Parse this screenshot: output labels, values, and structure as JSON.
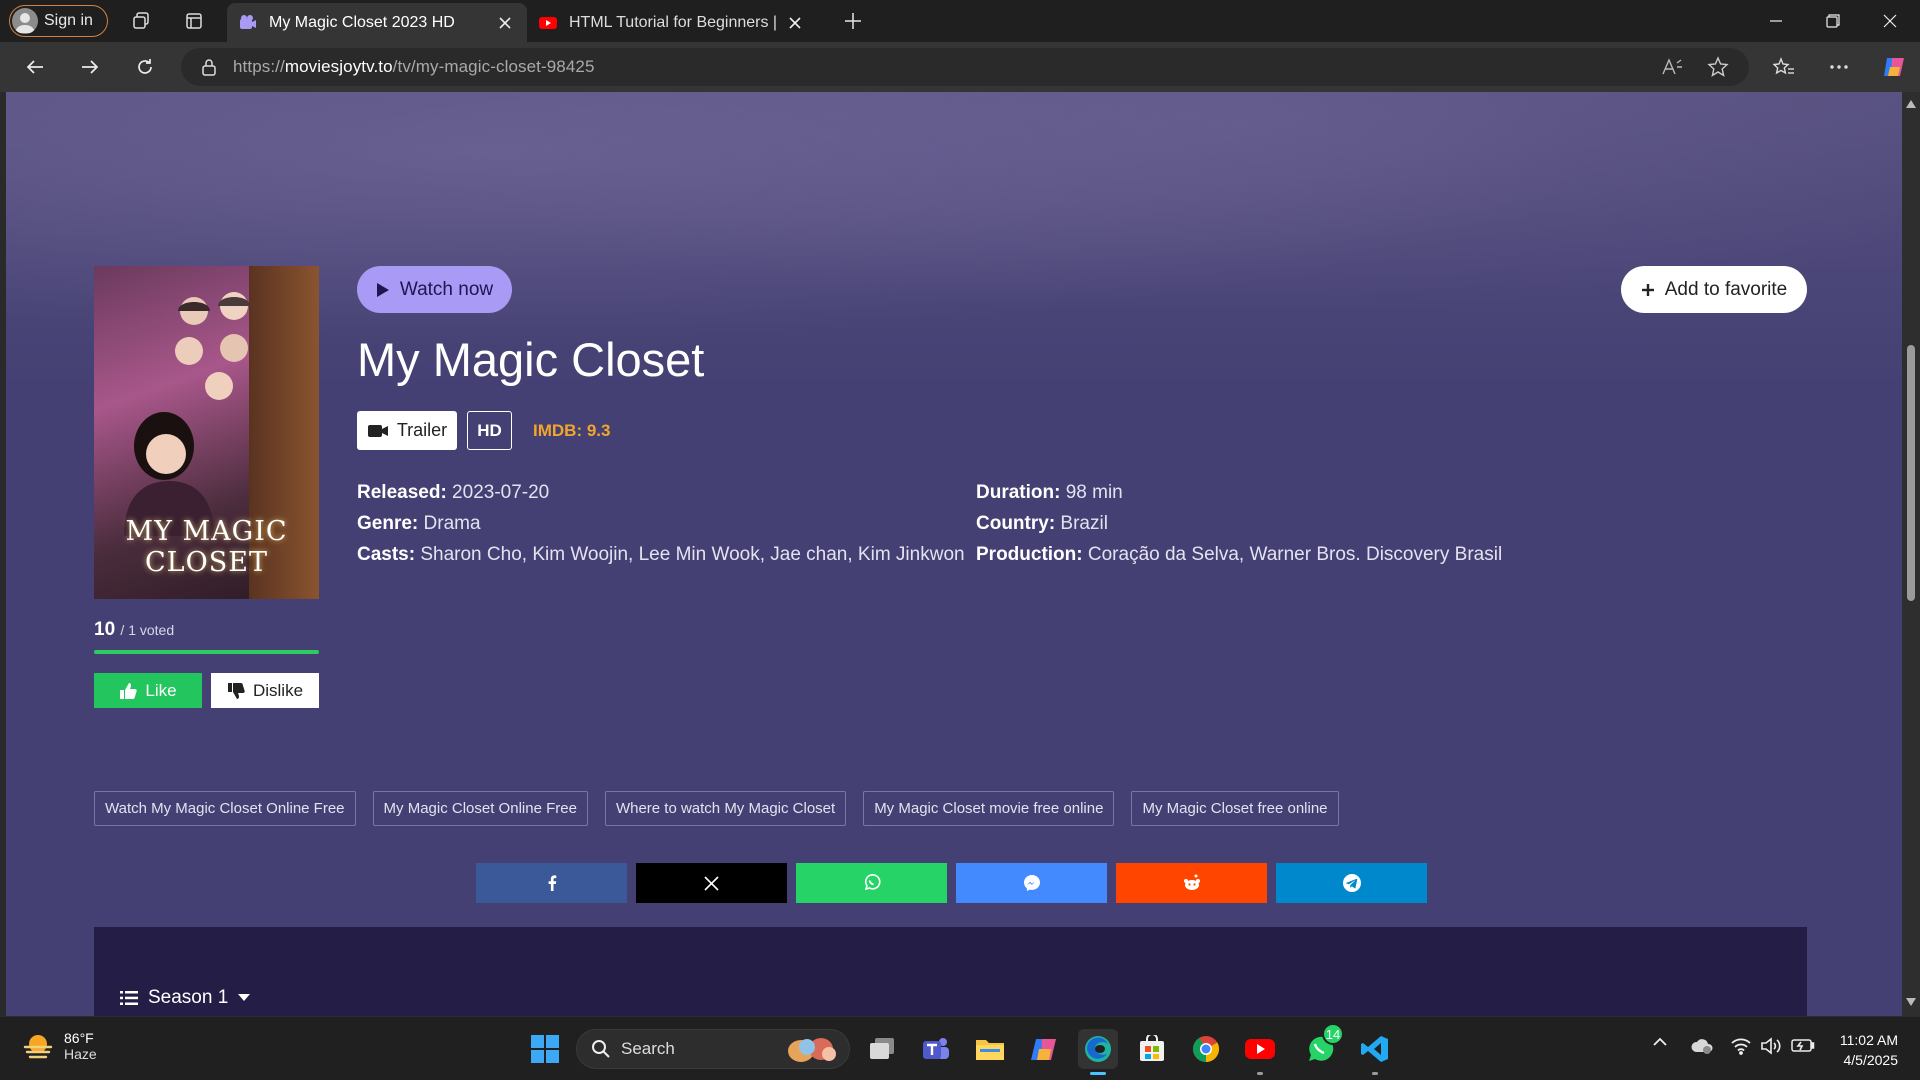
{
  "browser": {
    "signin_label": "Sign in",
    "tabs": [
      {
        "label": "My Magic Closet 2023 HD",
        "active": true
      },
      {
        "label": "HTML Tutorial for Beginners | Con",
        "active": false
      }
    ],
    "url_prefix": "https://",
    "url_domain": "moviesjoytv.to",
    "url_path": "/tv/my-magic-closet-98425"
  },
  "page": {
    "watch_now": "Watch now",
    "add_favorite": "Add to favorite",
    "title": "My Magic Closet",
    "poster_text_line1": "MY MAGIC",
    "poster_text_line2": "CLOSET",
    "trailer": "Trailer",
    "quality": "HD",
    "imdb": "IMDB: 9.3",
    "rating_score": "10",
    "rating_votes": "/ 1 voted",
    "like": "Like",
    "dislike": "Dislike",
    "meta_left": [
      {
        "key": "Released:",
        "value": " 2023-07-20"
      },
      {
        "key": "Genre:",
        "value": " Drama"
      },
      {
        "key": "Casts:",
        "value": " Sharon Cho, Kim Woojin, Lee Min Wook, Jae chan, Kim Jinkwon"
      }
    ],
    "meta_right": [
      {
        "key": "Duration:",
        "value": " 98 min"
      },
      {
        "key": "Country:",
        "value": " Brazil"
      },
      {
        "key": "Production:",
        "value": " Coração da Selva, Warner Bros. Discovery Brasil"
      }
    ],
    "tags": [
      "Watch My Magic Closet Online Free",
      "My Magic Closet Online Free",
      "Where to watch My Magic Closet",
      "My Magic Closet movie free online",
      "My Magic Closet free online"
    ],
    "share_buttons": [
      {
        "name": "facebook",
        "color": "#3b5998"
      },
      {
        "name": "x",
        "color": "#000000"
      },
      {
        "name": "whatsapp",
        "color": "#25d366"
      },
      {
        "name": "messenger",
        "color": "#448aff"
      },
      {
        "name": "reddit",
        "color": "#ff4500"
      },
      {
        "name": "telegram",
        "color": "#0088cc"
      }
    ],
    "season": "Season 1"
  },
  "taskbar": {
    "temperature": "86°F",
    "condition": "Haze",
    "search_placeholder": "Search",
    "whatsapp_badge": "14",
    "time": "11:02 AM",
    "date": "4/5/2025"
  },
  "colors": {
    "page_bg": "#444073",
    "accent": "#a89af5",
    "imdb": "#f3a52b",
    "like": "#22c55e"
  }
}
